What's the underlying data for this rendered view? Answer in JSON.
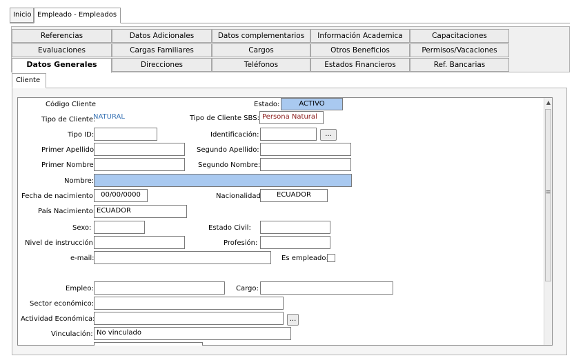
{
  "doc_tabs": [
    "Inicio",
    "Empleado - Empleados"
  ],
  "tabs_row1": [
    "Referencias",
    "Datos Adicionales",
    "Datos complementarios",
    "Información Academica",
    "Capacitaciones"
  ],
  "tabs_row2": [
    "Evaluaciones",
    "Cargas Familiares",
    "Cargos",
    "Otros Beneficios",
    "Permisos/Vacaciones"
  ],
  "tabs_row3": [
    "Datos Generales",
    "Direcciones",
    "Teléfonos",
    "Estados Financieros",
    "Ref. Bancarias"
  ],
  "subtab": "Cliente",
  "form": {
    "codigo_cliente_label": "Código Cliente",
    "estado_label": "Estado:",
    "estado_value": "ACTIVO",
    "tipo_cliente_label": "Tipo de Cliente:",
    "tipo_cliente_value": "NATURAL",
    "tipo_cliente_sbs_label": "Tipo de Cliente SBS:",
    "tipo_cliente_sbs_value": "Persona Natural",
    "tipo_id_label": "Tipo ID:",
    "tipo_id_value": "",
    "identificacion_label": "Identificación:",
    "identificacion_value": "",
    "primer_apellido_label": "Primer Apellido:",
    "primer_apellido_value": "",
    "segundo_apellido_label": "Segundo Apellido:",
    "segundo_apellido_value": "",
    "primer_nombre_label": "Primer Nombre:",
    "primer_nombre_value": "",
    "segundo_nombre_label": "Segundo Nombre:",
    "segundo_nombre_value": "",
    "nombre_label": "Nombre:",
    "nombre_value": "",
    "fecha_nacimiento_label": "Fecha de nacimiento:",
    "fecha_nacimiento_value": "00/00/0000",
    "nacionalidad_label": "Nacionalidad:",
    "nacionalidad_value": "ECUADOR",
    "pais_nacimiento_label": "País Nacimiento:",
    "pais_nacimiento_value": "ECUADOR",
    "sexo_label": "Sexo:",
    "sexo_value": "",
    "estado_civil_label": "Estado Civil:",
    "estado_civil_value": "",
    "nivel_instruccion_label": "Nivel de instrucción:",
    "nivel_instruccion_value": "",
    "profesion_label": "Profesión:",
    "profesion_value": "",
    "email_label": "e-mail:",
    "email_value": "",
    "es_empleado_label": "Es empleado:",
    "empleo_label": "Empleo:",
    "empleo_value": "",
    "cargo_label": "Cargo:",
    "cargo_value": "",
    "sector_economico_label": "Sector económico:",
    "sector_economico_value": "",
    "actividad_economica_label": "Actividad Económica:",
    "actividad_economica_value": "",
    "vinculacion_label": "Vinculación:",
    "vinculacion_value": "No vinculado",
    "lookup_button": "..."
  },
  "icons": {
    "scroll_up": "scroll-up-arrow-icon",
    "scroll_grip": "scroll-grip-icon"
  }
}
